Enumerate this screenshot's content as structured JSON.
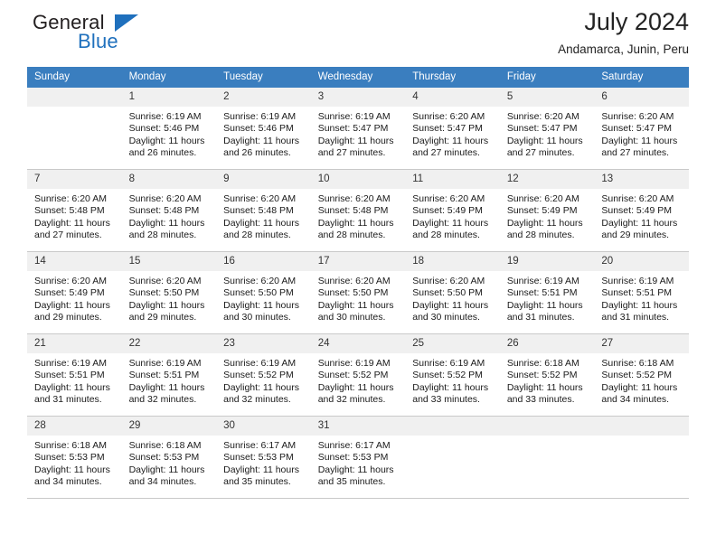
{
  "brand": {
    "name_part1": "General",
    "name_part2": "Blue",
    "triangle_icon": "triangle-icon",
    "accent_color": "#1f70bd"
  },
  "header": {
    "title": "July 2024",
    "subtitle": "Andamarca, Junin, Peru"
  },
  "calendar": {
    "header_color": "#3a7ebf",
    "daynum_background": "#f0f0f0",
    "weekday_headers": [
      "Sunday",
      "Monday",
      "Tuesday",
      "Wednesday",
      "Thursday",
      "Friday",
      "Saturday"
    ],
    "weeks": [
      [
        {
          "day": "",
          "blank": true,
          "sunrise": "",
          "sunset": "",
          "daylight_line1": "",
          "daylight_line2": ""
        },
        {
          "day": "1",
          "blank": false,
          "sunrise": "Sunrise: 6:19 AM",
          "sunset": "Sunset: 5:46 PM",
          "daylight_line1": "Daylight: 11 hours",
          "daylight_line2": "and 26 minutes."
        },
        {
          "day": "2",
          "blank": false,
          "sunrise": "Sunrise: 6:19 AM",
          "sunset": "Sunset: 5:46 PM",
          "daylight_line1": "Daylight: 11 hours",
          "daylight_line2": "and 26 minutes."
        },
        {
          "day": "3",
          "blank": false,
          "sunrise": "Sunrise: 6:19 AM",
          "sunset": "Sunset: 5:47 PM",
          "daylight_line1": "Daylight: 11 hours",
          "daylight_line2": "and 27 minutes."
        },
        {
          "day": "4",
          "blank": false,
          "sunrise": "Sunrise: 6:20 AM",
          "sunset": "Sunset: 5:47 PM",
          "daylight_line1": "Daylight: 11 hours",
          "daylight_line2": "and 27 minutes."
        },
        {
          "day": "5",
          "blank": false,
          "sunrise": "Sunrise: 6:20 AM",
          "sunset": "Sunset: 5:47 PM",
          "daylight_line1": "Daylight: 11 hours",
          "daylight_line2": "and 27 minutes."
        },
        {
          "day": "6",
          "blank": false,
          "sunrise": "Sunrise: 6:20 AM",
          "sunset": "Sunset: 5:47 PM",
          "daylight_line1": "Daylight: 11 hours",
          "daylight_line2": "and 27 minutes."
        }
      ],
      [
        {
          "day": "7",
          "blank": false,
          "sunrise": "Sunrise: 6:20 AM",
          "sunset": "Sunset: 5:48 PM",
          "daylight_line1": "Daylight: 11 hours",
          "daylight_line2": "and 27 minutes."
        },
        {
          "day": "8",
          "blank": false,
          "sunrise": "Sunrise: 6:20 AM",
          "sunset": "Sunset: 5:48 PM",
          "daylight_line1": "Daylight: 11 hours",
          "daylight_line2": "and 28 minutes."
        },
        {
          "day": "9",
          "blank": false,
          "sunrise": "Sunrise: 6:20 AM",
          "sunset": "Sunset: 5:48 PM",
          "daylight_line1": "Daylight: 11 hours",
          "daylight_line2": "and 28 minutes."
        },
        {
          "day": "10",
          "blank": false,
          "sunrise": "Sunrise: 6:20 AM",
          "sunset": "Sunset: 5:48 PM",
          "daylight_line1": "Daylight: 11 hours",
          "daylight_line2": "and 28 minutes."
        },
        {
          "day": "11",
          "blank": false,
          "sunrise": "Sunrise: 6:20 AM",
          "sunset": "Sunset: 5:49 PM",
          "daylight_line1": "Daylight: 11 hours",
          "daylight_line2": "and 28 minutes."
        },
        {
          "day": "12",
          "blank": false,
          "sunrise": "Sunrise: 6:20 AM",
          "sunset": "Sunset: 5:49 PM",
          "daylight_line1": "Daylight: 11 hours",
          "daylight_line2": "and 28 minutes."
        },
        {
          "day": "13",
          "blank": false,
          "sunrise": "Sunrise: 6:20 AM",
          "sunset": "Sunset: 5:49 PM",
          "daylight_line1": "Daylight: 11 hours",
          "daylight_line2": "and 29 minutes."
        }
      ],
      [
        {
          "day": "14",
          "blank": false,
          "sunrise": "Sunrise: 6:20 AM",
          "sunset": "Sunset: 5:49 PM",
          "daylight_line1": "Daylight: 11 hours",
          "daylight_line2": "and 29 minutes."
        },
        {
          "day": "15",
          "blank": false,
          "sunrise": "Sunrise: 6:20 AM",
          "sunset": "Sunset: 5:50 PM",
          "daylight_line1": "Daylight: 11 hours",
          "daylight_line2": "and 29 minutes."
        },
        {
          "day": "16",
          "blank": false,
          "sunrise": "Sunrise: 6:20 AM",
          "sunset": "Sunset: 5:50 PM",
          "daylight_line1": "Daylight: 11 hours",
          "daylight_line2": "and 30 minutes."
        },
        {
          "day": "17",
          "blank": false,
          "sunrise": "Sunrise: 6:20 AM",
          "sunset": "Sunset: 5:50 PM",
          "daylight_line1": "Daylight: 11 hours",
          "daylight_line2": "and 30 minutes."
        },
        {
          "day": "18",
          "blank": false,
          "sunrise": "Sunrise: 6:20 AM",
          "sunset": "Sunset: 5:50 PM",
          "daylight_line1": "Daylight: 11 hours",
          "daylight_line2": "and 30 minutes."
        },
        {
          "day": "19",
          "blank": false,
          "sunrise": "Sunrise: 6:19 AM",
          "sunset": "Sunset: 5:51 PM",
          "daylight_line1": "Daylight: 11 hours",
          "daylight_line2": "and 31 minutes."
        },
        {
          "day": "20",
          "blank": false,
          "sunrise": "Sunrise: 6:19 AM",
          "sunset": "Sunset: 5:51 PM",
          "daylight_line1": "Daylight: 11 hours",
          "daylight_line2": "and 31 minutes."
        }
      ],
      [
        {
          "day": "21",
          "blank": false,
          "sunrise": "Sunrise: 6:19 AM",
          "sunset": "Sunset: 5:51 PM",
          "daylight_line1": "Daylight: 11 hours",
          "daylight_line2": "and 31 minutes."
        },
        {
          "day": "22",
          "blank": false,
          "sunrise": "Sunrise: 6:19 AM",
          "sunset": "Sunset: 5:51 PM",
          "daylight_line1": "Daylight: 11 hours",
          "daylight_line2": "and 32 minutes."
        },
        {
          "day": "23",
          "blank": false,
          "sunrise": "Sunrise: 6:19 AM",
          "sunset": "Sunset: 5:52 PM",
          "daylight_line1": "Daylight: 11 hours",
          "daylight_line2": "and 32 minutes."
        },
        {
          "day": "24",
          "blank": false,
          "sunrise": "Sunrise: 6:19 AM",
          "sunset": "Sunset: 5:52 PM",
          "daylight_line1": "Daylight: 11 hours",
          "daylight_line2": "and 32 minutes."
        },
        {
          "day": "25",
          "blank": false,
          "sunrise": "Sunrise: 6:19 AM",
          "sunset": "Sunset: 5:52 PM",
          "daylight_line1": "Daylight: 11 hours",
          "daylight_line2": "and 33 minutes."
        },
        {
          "day": "26",
          "blank": false,
          "sunrise": "Sunrise: 6:18 AM",
          "sunset": "Sunset: 5:52 PM",
          "daylight_line1": "Daylight: 11 hours",
          "daylight_line2": "and 33 minutes."
        },
        {
          "day": "27",
          "blank": false,
          "sunrise": "Sunrise: 6:18 AM",
          "sunset": "Sunset: 5:52 PM",
          "daylight_line1": "Daylight: 11 hours",
          "daylight_line2": "and 34 minutes."
        }
      ],
      [
        {
          "day": "28",
          "blank": false,
          "sunrise": "Sunrise: 6:18 AM",
          "sunset": "Sunset: 5:53 PM",
          "daylight_line1": "Daylight: 11 hours",
          "daylight_line2": "and 34 minutes."
        },
        {
          "day": "29",
          "blank": false,
          "sunrise": "Sunrise: 6:18 AM",
          "sunset": "Sunset: 5:53 PM",
          "daylight_line1": "Daylight: 11 hours",
          "daylight_line2": "and 34 minutes."
        },
        {
          "day": "30",
          "blank": false,
          "sunrise": "Sunrise: 6:17 AM",
          "sunset": "Sunset: 5:53 PM",
          "daylight_line1": "Daylight: 11 hours",
          "daylight_line2": "and 35 minutes."
        },
        {
          "day": "31",
          "blank": false,
          "sunrise": "Sunrise: 6:17 AM",
          "sunset": "Sunset: 5:53 PM",
          "daylight_line1": "Daylight: 11 hours",
          "daylight_line2": "and 35 minutes."
        },
        {
          "day": "",
          "blank": true,
          "sunrise": "",
          "sunset": "",
          "daylight_line1": "",
          "daylight_line2": ""
        },
        {
          "day": "",
          "blank": true,
          "sunrise": "",
          "sunset": "",
          "daylight_line1": "",
          "daylight_line2": ""
        },
        {
          "day": "",
          "blank": true,
          "sunrise": "",
          "sunset": "",
          "daylight_line1": "",
          "daylight_line2": ""
        }
      ]
    ]
  }
}
